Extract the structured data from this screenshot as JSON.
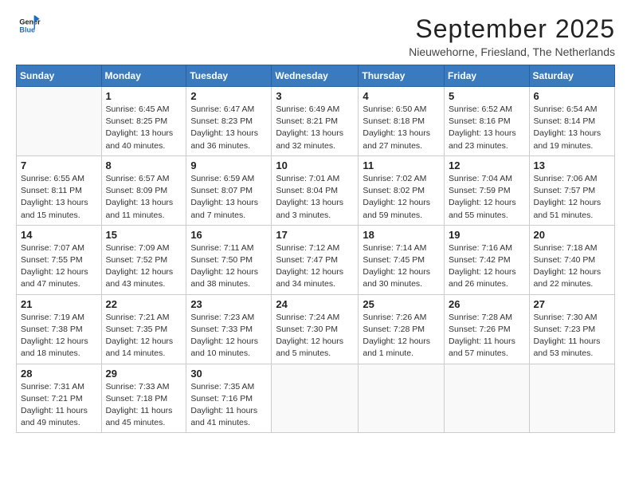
{
  "header": {
    "logo_line1": "General",
    "logo_line2": "Blue",
    "month": "September 2025",
    "location": "Nieuwehorne, Friesland, The Netherlands"
  },
  "days_of_week": [
    "Sunday",
    "Monday",
    "Tuesday",
    "Wednesday",
    "Thursday",
    "Friday",
    "Saturday"
  ],
  "weeks": [
    [
      {
        "day": "",
        "info": ""
      },
      {
        "day": "1",
        "sunrise": "6:45 AM",
        "sunset": "8:25 PM",
        "daylight": "13 hours and 40 minutes."
      },
      {
        "day": "2",
        "sunrise": "6:47 AM",
        "sunset": "8:23 PM",
        "daylight": "13 hours and 36 minutes."
      },
      {
        "day": "3",
        "sunrise": "6:49 AM",
        "sunset": "8:21 PM",
        "daylight": "13 hours and 32 minutes."
      },
      {
        "day": "4",
        "sunrise": "6:50 AM",
        "sunset": "8:18 PM",
        "daylight": "13 hours and 27 minutes."
      },
      {
        "day": "5",
        "sunrise": "6:52 AM",
        "sunset": "8:16 PM",
        "daylight": "13 hours and 23 minutes."
      },
      {
        "day": "6",
        "sunrise": "6:54 AM",
        "sunset": "8:14 PM",
        "daylight": "13 hours and 19 minutes."
      }
    ],
    [
      {
        "day": "7",
        "sunrise": "6:55 AM",
        "sunset": "8:11 PM",
        "daylight": "13 hours and 15 minutes."
      },
      {
        "day": "8",
        "sunrise": "6:57 AM",
        "sunset": "8:09 PM",
        "daylight": "13 hours and 11 minutes."
      },
      {
        "day": "9",
        "sunrise": "6:59 AM",
        "sunset": "8:07 PM",
        "daylight": "13 hours and 7 minutes."
      },
      {
        "day": "10",
        "sunrise": "7:01 AM",
        "sunset": "8:04 PM",
        "daylight": "13 hours and 3 minutes."
      },
      {
        "day": "11",
        "sunrise": "7:02 AM",
        "sunset": "8:02 PM",
        "daylight": "12 hours and 59 minutes."
      },
      {
        "day": "12",
        "sunrise": "7:04 AM",
        "sunset": "7:59 PM",
        "daylight": "12 hours and 55 minutes."
      },
      {
        "day": "13",
        "sunrise": "7:06 AM",
        "sunset": "7:57 PM",
        "daylight": "12 hours and 51 minutes."
      }
    ],
    [
      {
        "day": "14",
        "sunrise": "7:07 AM",
        "sunset": "7:55 PM",
        "daylight": "12 hours and 47 minutes."
      },
      {
        "day": "15",
        "sunrise": "7:09 AM",
        "sunset": "7:52 PM",
        "daylight": "12 hours and 43 minutes."
      },
      {
        "day": "16",
        "sunrise": "7:11 AM",
        "sunset": "7:50 PM",
        "daylight": "12 hours and 38 minutes."
      },
      {
        "day": "17",
        "sunrise": "7:12 AM",
        "sunset": "7:47 PM",
        "daylight": "12 hours and 34 minutes."
      },
      {
        "day": "18",
        "sunrise": "7:14 AM",
        "sunset": "7:45 PM",
        "daylight": "12 hours and 30 minutes."
      },
      {
        "day": "19",
        "sunrise": "7:16 AM",
        "sunset": "7:42 PM",
        "daylight": "12 hours and 26 minutes."
      },
      {
        "day": "20",
        "sunrise": "7:18 AM",
        "sunset": "7:40 PM",
        "daylight": "12 hours and 22 minutes."
      }
    ],
    [
      {
        "day": "21",
        "sunrise": "7:19 AM",
        "sunset": "7:38 PM",
        "daylight": "12 hours and 18 minutes."
      },
      {
        "day": "22",
        "sunrise": "7:21 AM",
        "sunset": "7:35 PM",
        "daylight": "12 hours and 14 minutes."
      },
      {
        "day": "23",
        "sunrise": "7:23 AM",
        "sunset": "7:33 PM",
        "daylight": "12 hours and 10 minutes."
      },
      {
        "day": "24",
        "sunrise": "7:24 AM",
        "sunset": "7:30 PM",
        "daylight": "12 hours and 5 minutes."
      },
      {
        "day": "25",
        "sunrise": "7:26 AM",
        "sunset": "7:28 PM",
        "daylight": "12 hours and 1 minute."
      },
      {
        "day": "26",
        "sunrise": "7:28 AM",
        "sunset": "7:26 PM",
        "daylight": "11 hours and 57 minutes."
      },
      {
        "day": "27",
        "sunrise": "7:30 AM",
        "sunset": "7:23 PM",
        "daylight": "11 hours and 53 minutes."
      }
    ],
    [
      {
        "day": "28",
        "sunrise": "7:31 AM",
        "sunset": "7:21 PM",
        "daylight": "11 hours and 49 minutes."
      },
      {
        "day": "29",
        "sunrise": "7:33 AM",
        "sunset": "7:18 PM",
        "daylight": "11 hours and 45 minutes."
      },
      {
        "day": "30",
        "sunrise": "7:35 AM",
        "sunset": "7:16 PM",
        "daylight": "11 hours and 41 minutes."
      },
      {
        "day": "",
        "info": ""
      },
      {
        "day": "",
        "info": ""
      },
      {
        "day": "",
        "info": ""
      },
      {
        "day": "",
        "info": ""
      }
    ]
  ],
  "labels": {
    "sunrise": "Sunrise:",
    "sunset": "Sunset:",
    "daylight": "Daylight:"
  }
}
